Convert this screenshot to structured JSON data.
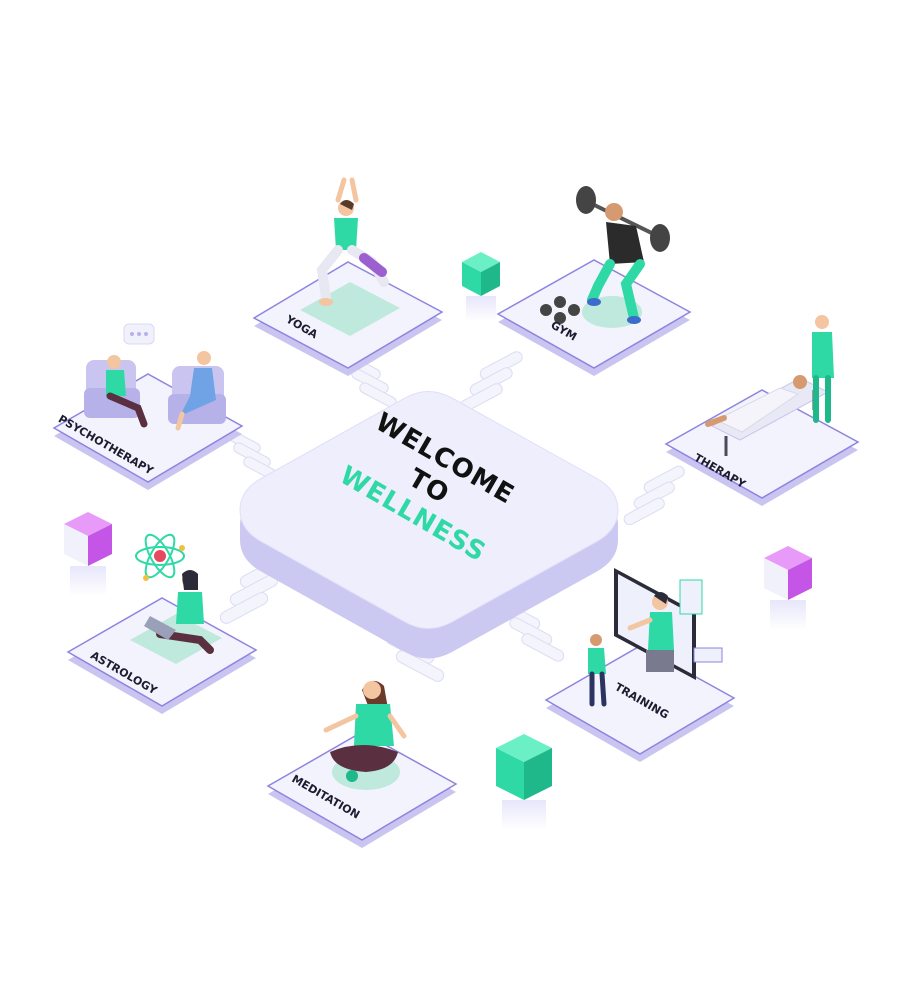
{
  "hub": {
    "line1": "WELCOME",
    "line2": "TO",
    "line3": "WELLNESS"
  },
  "tiles": {
    "yoga": "YOGA",
    "gym": "GYM",
    "psychotherapy": "PSYCHOTHERAPY",
    "therapy": "THERAPY",
    "astrology": "ASTROLOGY",
    "training": "TRAINING",
    "meditation": "MEDITATION"
  },
  "colors": {
    "accent_green": "#2fd9a6",
    "accent_purple": "#c455e6",
    "tile": "#f1f2fc",
    "tile_edge": "#8e84e0",
    "text_dark": "#111111"
  }
}
